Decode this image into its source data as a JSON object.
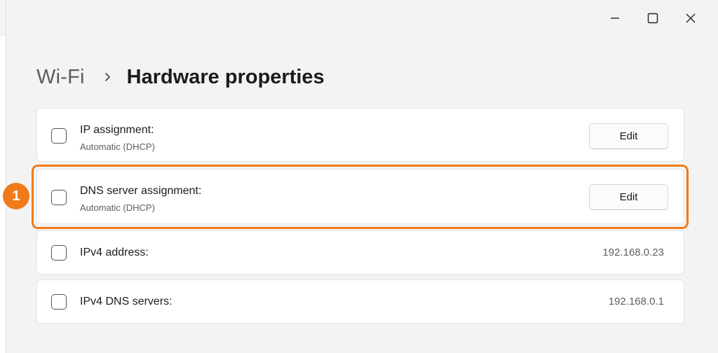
{
  "window": {
    "controls": {
      "minimize": "minimize-icon",
      "maximize": "maximize-icon",
      "close": "close-icon"
    }
  },
  "breadcrumb": {
    "parent": "Wi-Fi",
    "separator_icon": "chevron-right-icon",
    "current": "Hardware properties"
  },
  "rows": [
    {
      "label": "IP assignment:",
      "sublabel": "Automatic (DHCP)",
      "action": "Edit"
    },
    {
      "label": "DNS server assignment:",
      "sublabel": "Automatic (DHCP)",
      "action": "Edit"
    },
    {
      "label": "IPv4 address:",
      "value": "192.168.0.23"
    },
    {
      "label": "IPv4 DNS servers:",
      "value": "192.168.0.1"
    }
  ],
  "annotation": {
    "step_number": "1",
    "color": "#f07a1a"
  }
}
